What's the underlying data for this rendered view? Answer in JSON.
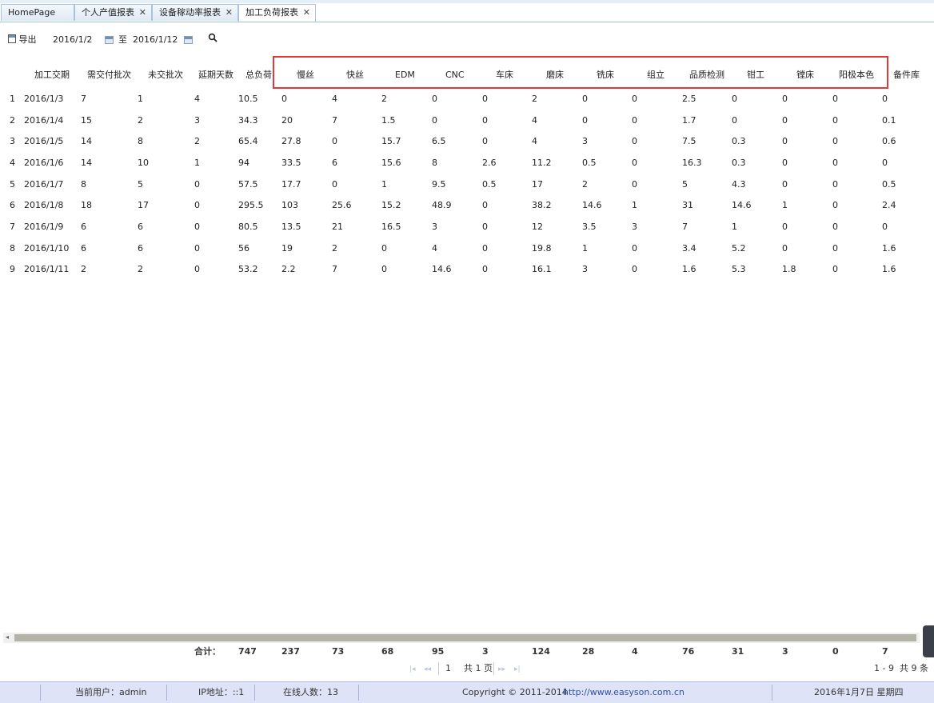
{
  "tabs": [
    {
      "label": "HomePage",
      "closable": false
    },
    {
      "label": "个人产值报表",
      "closable": true
    },
    {
      "label": "设备稼动率报表",
      "closable": true
    },
    {
      "label": "加工负荷报表",
      "closable": true,
      "active": true
    }
  ],
  "toolbar": {
    "export_label": "导出",
    "date_from": "2016/1/2",
    "to_label": "至",
    "date_to": "2016/1/12"
  },
  "table": {
    "columns": [
      "加工交期",
      "需交付批次",
      "未交批次",
      "延期天数",
      "总负荷",
      "慢丝",
      "快丝",
      "EDM",
      "CNC",
      "车床",
      "磨床",
      "铣床",
      "组立",
      "品质检测",
      "钳工",
      "镗床",
      "阳极本色",
      "备件库"
    ],
    "rows": [
      {
        "n": "1",
        "cells": [
          "2016/1/3",
          "7",
          "1",
          "4",
          "10.5",
          "0",
          "4",
          "2",
          "0",
          "0",
          "2",
          "0",
          "0",
          "2.5",
          "0",
          "0",
          "0",
          "0"
        ]
      },
      {
        "n": "2",
        "cells": [
          "2016/1/4",
          "15",
          "2",
          "3",
          "34.3",
          "20",
          "7",
          "1.5",
          "0",
          "0",
          "4",
          "0",
          "0",
          "1.7",
          "0",
          "0",
          "0",
          "0.1"
        ]
      },
      {
        "n": "3",
        "cells": [
          "2016/1/5",
          "14",
          "8",
          "2",
          "65.4",
          "27.8",
          "0",
          "15.7",
          "6.5",
          "0",
          "4",
          "3",
          "0",
          "7.5",
          "0.3",
          "0",
          "0",
          "0.6"
        ]
      },
      {
        "n": "4",
        "cells": [
          "2016/1/6",
          "14",
          "10",
          "1",
          "94",
          "33.5",
          "6",
          "15.6",
          "8",
          "2.6",
          "11.2",
          "0.5",
          "0",
          "16.3",
          "0.3",
          "0",
          "0",
          "0"
        ]
      },
      {
        "n": "5",
        "cells": [
          "2016/1/7",
          "8",
          "5",
          "0",
          "57.5",
          "17.7",
          "0",
          "1",
          "9.5",
          "0.5",
          "17",
          "2",
          "0",
          "5",
          "4.3",
          "0",
          "0",
          "0.5"
        ]
      },
      {
        "n": "6",
        "cells": [
          "2016/1/8",
          "18",
          "17",
          "0",
          "295.5",
          "103",
          "25.6",
          "15.2",
          "48.9",
          "0",
          "38.2",
          "14.6",
          "1",
          "31",
          "14.6",
          "1",
          "0",
          "2.4"
        ]
      },
      {
        "n": "7",
        "cells": [
          "2016/1/9",
          "6",
          "6",
          "0",
          "80.5",
          "13.5",
          "21",
          "16.5",
          "3",
          "0",
          "12",
          "3.5",
          "3",
          "7",
          "1",
          "0",
          "0",
          "0"
        ]
      },
      {
        "n": "8",
        "cells": [
          "2016/1/10",
          "6",
          "6",
          "0",
          "56",
          "19",
          "2",
          "0",
          "4",
          "0",
          "19.8",
          "1",
          "0",
          "3.4",
          "5.2",
          "0",
          "0",
          "1.6"
        ]
      },
      {
        "n": "9",
        "cells": [
          "2016/1/11",
          "2",
          "2",
          "0",
          "53.2",
          "2.2",
          "7",
          "0",
          "14.6",
          "0",
          "16.1",
          "3",
          "0",
          "1.6",
          "5.3",
          "1.8",
          "0",
          "1.6"
        ]
      }
    ],
    "totals_label": "合计：",
    "totals": [
      "747",
      "237",
      "73",
      "68",
      "95",
      "3",
      "124",
      "28",
      "4",
      "76",
      "31",
      "3",
      "0",
      "7"
    ]
  },
  "pager": {
    "page": "1",
    "total_pages": "共 1 页",
    "range": "1 - 9",
    "count": "共 9 条"
  },
  "status": {
    "user": "当前用户：admin",
    "ip": "IP地址：::1",
    "online": "在线人数：13",
    "copyright": "Copyright © 2011-2014",
    "url": "http://www.easyson.com.cn",
    "date": "2016年1月7日 星期四"
  },
  "colors": {
    "highlight_box": "#e03a3a",
    "status_bg": "#dfe3f7",
    "scroll_thumb": "#b3b3a6",
    "link": "#2d50a8"
  }
}
